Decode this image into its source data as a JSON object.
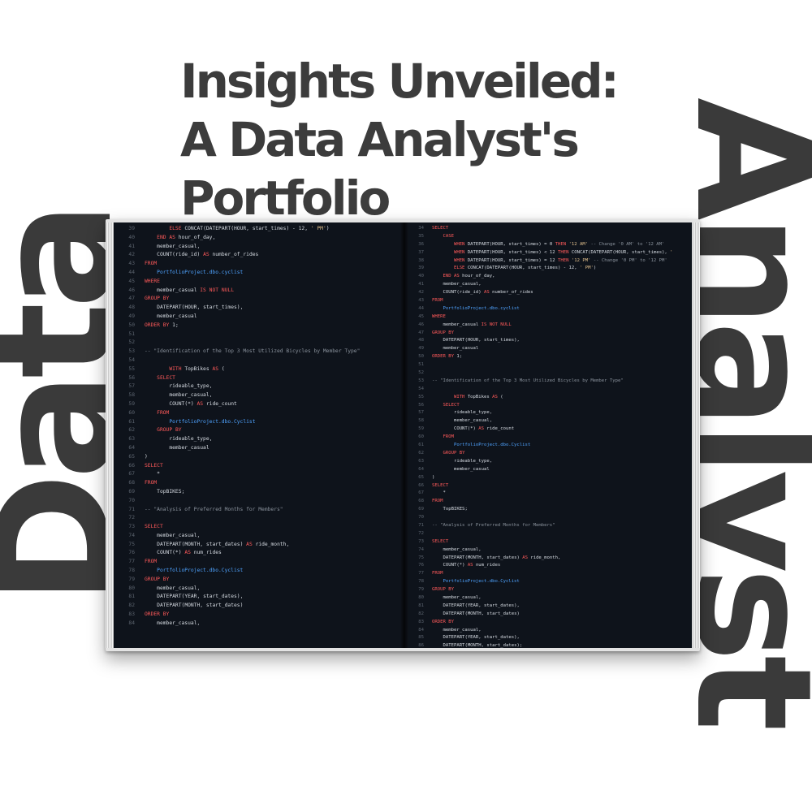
{
  "title_lines": [
    "Insights Unveiled:",
    "A Data Analyst's",
    "Portfolio"
  ],
  "side_words": {
    "left": "Data",
    "right": "Analyst"
  },
  "colors": {
    "text_dark": "#3c3c3c",
    "page_bg": "#0e131b",
    "line_number": "#5d6570",
    "plain": "#d6dbe2",
    "keyword": "#ff5a5a",
    "identifier": "#4fa3ff",
    "comment": "#8a929c",
    "string": "#e2c08d"
  },
  "left_page": {
    "lines": [
      {
        "n": "39",
        "text": "ELSE CONCAT(DATEPART(HOUR, start_times) - 12, ' PM')",
        "indent": 4
      },
      {
        "n": "40",
        "text": "END AS hour_of_day,",
        "indent": 2
      },
      {
        "n": "41",
        "text": "member_casual,",
        "indent": 2
      },
      {
        "n": "42",
        "text": "COUNT(ride_id) AS number_of_rides",
        "indent": 2
      },
      {
        "n": "43",
        "text": "FROM",
        "indent": 0
      },
      {
        "n": "44",
        "text": "PortfolioProject.dbo.cyclist",
        "indent": 2
      },
      {
        "n": "45",
        "text": "WHERE",
        "indent": 0
      },
      {
        "n": "46",
        "text": "member_casual IS NOT NULL",
        "indent": 2
      },
      {
        "n": "47",
        "text": "GROUP BY",
        "indent": 0
      },
      {
        "n": "48",
        "text": "DATEPART(HOUR, start_times),",
        "indent": 2
      },
      {
        "n": "49",
        "text": "member_casual",
        "indent": 2
      },
      {
        "n": "50",
        "text": "ORDER BY 1;",
        "indent": 0
      },
      {
        "n": "51",
        "text": "",
        "indent": 0
      },
      {
        "n": "52",
        "text": "",
        "indent": 0
      },
      {
        "n": "53",
        "text": "-- \"Identification of the Top 3 Most Utilized Bicycles by Member Type\"",
        "indent": 0
      },
      {
        "n": "54",
        "text": "",
        "indent": 0
      },
      {
        "n": "55",
        "text": "WITH TopBikes AS (",
        "indent": 4
      },
      {
        "n": "56",
        "text": "SELECT",
        "indent": 2
      },
      {
        "n": "57",
        "text": "rideable_type,",
        "indent": 4
      },
      {
        "n": "58",
        "text": "member_casual,",
        "indent": 4
      },
      {
        "n": "59",
        "text": "COUNT(*) AS ride_count",
        "indent": 4
      },
      {
        "n": "60",
        "text": "FROM",
        "indent": 2
      },
      {
        "n": "61",
        "text": "PortfolioProject.dbo.Cyclist",
        "indent": 4
      },
      {
        "n": "62",
        "text": "GROUP BY",
        "indent": 2
      },
      {
        "n": "63",
        "text": "rideable_type,",
        "indent": 4
      },
      {
        "n": "64",
        "text": "member_casual",
        "indent": 4
      },
      {
        "n": "65",
        "text": ")",
        "indent": 0
      },
      {
        "n": "66",
        "text": "SELECT",
        "indent": 0
      },
      {
        "n": "67",
        "text": "*",
        "indent": 2
      },
      {
        "n": "68",
        "text": "FROM",
        "indent": 0
      },
      {
        "n": "69",
        "text": "TopBIKES;",
        "indent": 2
      },
      {
        "n": "70",
        "text": "",
        "indent": 0
      },
      {
        "n": "71",
        "text": "-- \"Analysis of Preferred Months for Members\"",
        "indent": 0
      },
      {
        "n": "72",
        "text": "",
        "indent": 0
      },
      {
        "n": "73",
        "text": "SELECT",
        "indent": 0
      },
      {
        "n": "74",
        "text": "member_casual,",
        "indent": 2
      },
      {
        "n": "75",
        "text": "DATEPART(MONTH, start_dates) AS ride_month,",
        "indent": 2
      },
      {
        "n": "76",
        "text": "COUNT(*) AS num_rides",
        "indent": 2
      },
      {
        "n": "77",
        "text": "FROM",
        "indent": 0
      },
      {
        "n": "78",
        "text": "PortfolioProject.dbo.Cyclist",
        "indent": 2
      },
      {
        "n": "79",
        "text": "GROUP BY",
        "indent": 0
      },
      {
        "n": "80",
        "text": "member_casual,",
        "indent": 2
      },
      {
        "n": "81",
        "text": "DATEPART(YEAR, start_dates),",
        "indent": 2
      },
      {
        "n": "82",
        "text": "DATEPART(MONTH, start_dates)",
        "indent": 2
      },
      {
        "n": "83",
        "text": "ORDER BY",
        "indent": 0
      },
      {
        "n": "84",
        "text": "member_casual,",
        "indent": 2
      }
    ]
  },
  "right_page": {
    "lines": [
      {
        "n": "34",
        "text": "SELECT",
        "indent": 0
      },
      {
        "n": "35",
        "text": "CASE",
        "indent": 2
      },
      {
        "n": "36",
        "text": "WHEN DATEPART(HOUR, start_times) = 0 THEN '12 AM' -- Change '0 AM' to '12 AM'",
        "indent": 4
      },
      {
        "n": "37",
        "text": "WHEN DATEPART(HOUR, start_times) < 12 THEN CONCAT(DATEPART(HOUR, start_times), '",
        "indent": 4
      },
      {
        "n": "38",
        "text": "WHEN DATEPART(HOUR, start_times) = 12 THEN '12 PM' -- Change '0 PM' to '12 PM'",
        "indent": 4
      },
      {
        "n": "39",
        "text": "ELSE CONCAT(DATEPART(HOUR, start_times) - 12, ' PM')",
        "indent": 4
      },
      {
        "n": "40",
        "text": "END AS hour_of_day,",
        "indent": 2
      },
      {
        "n": "41",
        "text": "member_casual,",
        "indent": 2
      },
      {
        "n": "42",
        "text": "COUNT(ride_id) AS number_of_rides",
        "indent": 2
      },
      {
        "n": "43",
        "text": "FROM",
        "indent": 0
      },
      {
        "n": "44",
        "text": "PortfolioProject.dbo.cyclist",
        "indent": 2
      },
      {
        "n": "45",
        "text": "WHERE",
        "indent": 0
      },
      {
        "n": "46",
        "text": "member_casual IS NOT NULL",
        "indent": 2
      },
      {
        "n": "47",
        "text": "GROUP BY",
        "indent": 0
      },
      {
        "n": "48",
        "text": "DATEPART(HOUR, start_times),",
        "indent": 2
      },
      {
        "n": "49",
        "text": "member_casual",
        "indent": 2
      },
      {
        "n": "50",
        "text": "ORDER BY 1;",
        "indent": 0
      },
      {
        "n": "51",
        "text": "",
        "indent": 0
      },
      {
        "n": "52",
        "text": "",
        "indent": 0
      },
      {
        "n": "53",
        "text": "-- \"Identification of the Top 3 Most Utilized Bicycles by Member Type\"",
        "indent": 0
      },
      {
        "n": "54",
        "text": "",
        "indent": 0
      },
      {
        "n": "55",
        "text": "WITH TopBikes AS (",
        "indent": 4
      },
      {
        "n": "56",
        "text": "SELECT",
        "indent": 2
      },
      {
        "n": "57",
        "text": "rideable_type,",
        "indent": 4
      },
      {
        "n": "58",
        "text": "member_casual,",
        "indent": 4
      },
      {
        "n": "59",
        "text": "COUNT(*) AS ride_count",
        "indent": 4
      },
      {
        "n": "60",
        "text": "FROM",
        "indent": 2
      },
      {
        "n": "61",
        "text": "PortfolioProject.dbo.Cyclist",
        "indent": 4
      },
      {
        "n": "62",
        "text": "GROUP BY",
        "indent": 2
      },
      {
        "n": "63",
        "text": "rideable_type,",
        "indent": 4
      },
      {
        "n": "64",
        "text": "member_casual",
        "indent": 4
      },
      {
        "n": "65",
        "text": ")",
        "indent": 0
      },
      {
        "n": "66",
        "text": "SELECT",
        "indent": 0
      },
      {
        "n": "67",
        "text": "*",
        "indent": 2
      },
      {
        "n": "68",
        "text": "FROM",
        "indent": 0
      },
      {
        "n": "69",
        "text": "TopBIKES;",
        "indent": 2
      },
      {
        "n": "70",
        "text": "",
        "indent": 0
      },
      {
        "n": "71",
        "text": "-- \"Analysis of Preferred Months for Members\"",
        "indent": 0
      },
      {
        "n": "72",
        "text": "",
        "indent": 0
      },
      {
        "n": "73",
        "text": "SELECT",
        "indent": 0
      },
      {
        "n": "74",
        "text": "member_casual,",
        "indent": 2
      },
      {
        "n": "75",
        "text": "DATEPART(MONTH, start_dates) AS ride_month,",
        "indent": 2
      },
      {
        "n": "76",
        "text": "COUNT(*) AS num_rides",
        "indent": 2
      },
      {
        "n": "77",
        "text": "FROM",
        "indent": 0
      },
      {
        "n": "78",
        "text": "PortfolioProject.dbo.Cyclist",
        "indent": 2
      },
      {
        "n": "79",
        "text": "GROUP BY",
        "indent": 0
      },
      {
        "n": "80",
        "text": "member_casual,",
        "indent": 2
      },
      {
        "n": "81",
        "text": "DATEPART(YEAR, start_dates),",
        "indent": 2
      },
      {
        "n": "82",
        "text": "DATEPART(MONTH, start_dates)",
        "indent": 2
      },
      {
        "n": "83",
        "text": "ORDER BY",
        "indent": 0
      },
      {
        "n": "84",
        "text": "member_casual,",
        "indent": 2
      },
      {
        "n": "85",
        "text": "DATEPART(YEAR, start_dates),",
        "indent": 2
      },
      {
        "n": "86",
        "text": "DATEPART(MONTH, start_dates);",
        "indent": 2
      }
    ]
  }
}
